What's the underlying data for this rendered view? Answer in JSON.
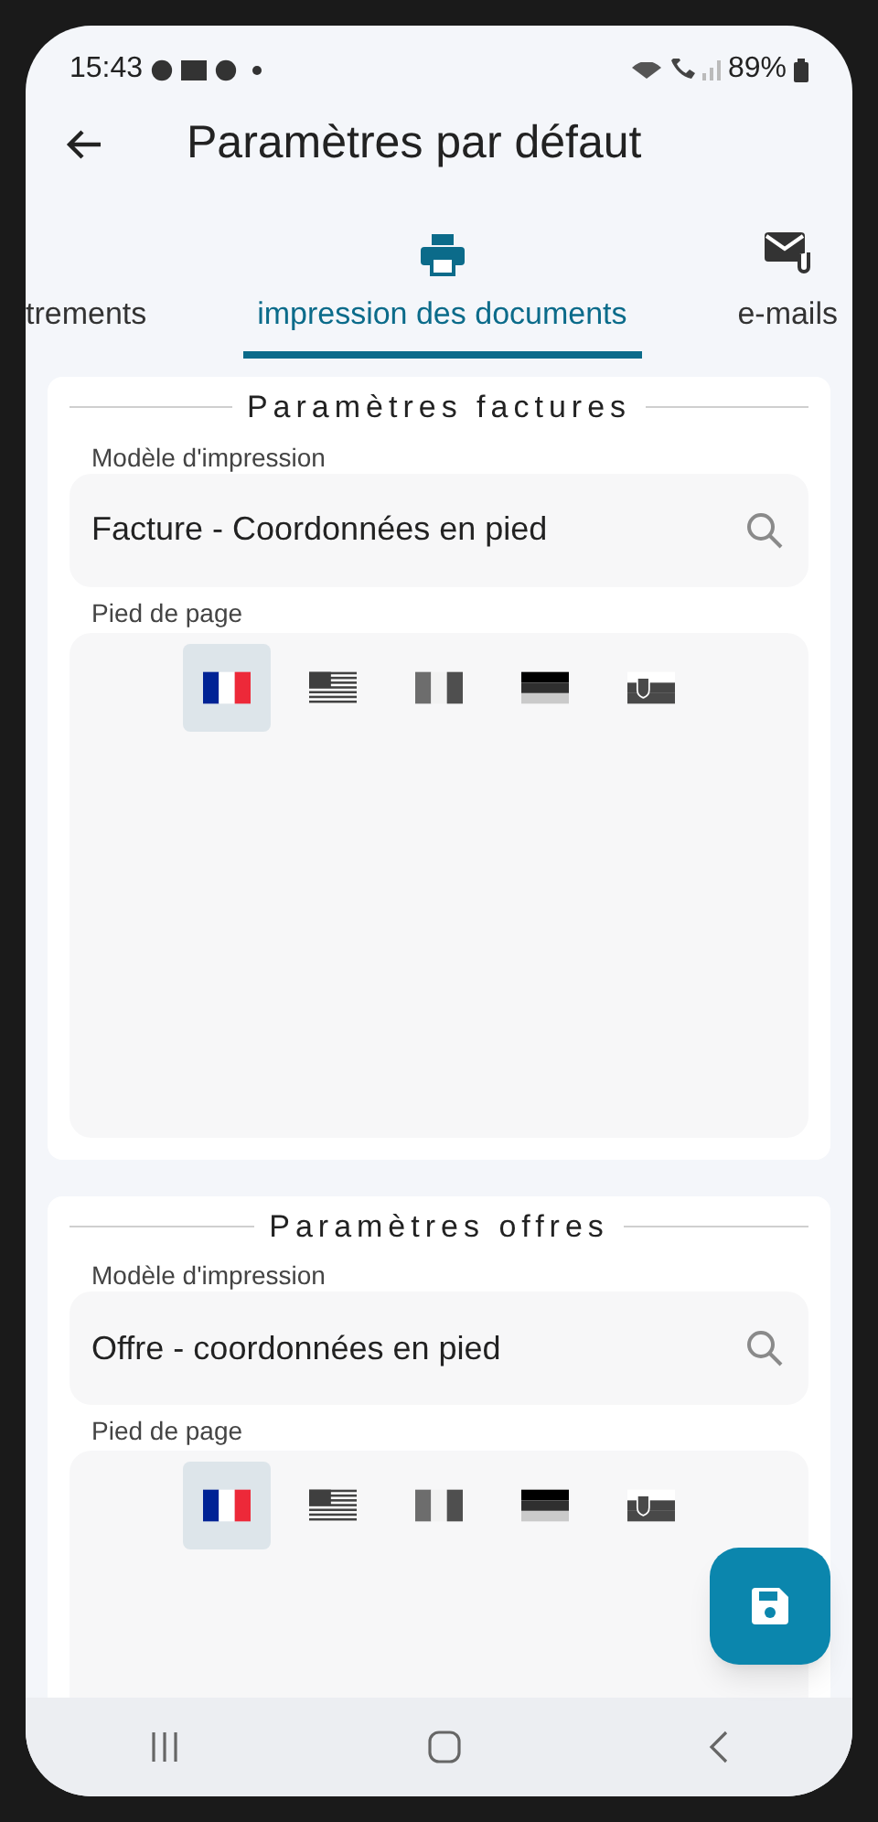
{
  "status_bar": {
    "time": "15:43",
    "battery": "89%"
  },
  "header": {
    "title": "Paramètres par défaut"
  },
  "tabs": [
    {
      "label": "trements",
      "kind": "plain",
      "selected": false
    },
    {
      "label": "impression des documents",
      "kind": "printer",
      "selected": true
    },
    {
      "label": "e-mails",
      "kind": "mail",
      "selected": false
    }
  ],
  "sections": [
    {
      "title": "Paramètres factures",
      "template_label": "Modèle d'impression",
      "template_value": "Facture - Coordonnées en pied",
      "footer_label": "Pied de page",
      "flags": [
        {
          "kind": "fr",
          "selected": true
        },
        {
          "kind": "us",
          "selected": false
        },
        {
          "kind": "it",
          "selected": false
        },
        {
          "kind": "de",
          "selected": false
        },
        {
          "kind": "sk",
          "selected": false
        }
      ]
    },
    {
      "title": "Paramètres offres",
      "template_label": "Modèle d'impression",
      "template_value": "Offre - coordonnées en pied",
      "footer_label": "Pied de page",
      "flags": [
        {
          "kind": "fr",
          "selected": true
        },
        {
          "kind": "us",
          "selected": false
        },
        {
          "kind": "it",
          "selected": false
        },
        {
          "kind": "de",
          "selected": false
        },
        {
          "kind": "sk",
          "selected": false
        }
      ]
    }
  ]
}
